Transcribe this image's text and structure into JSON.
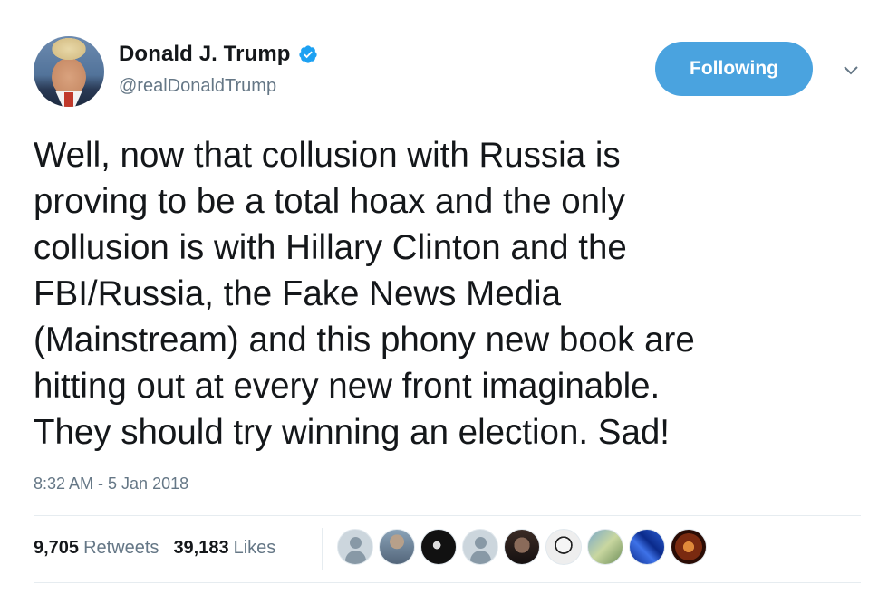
{
  "user": {
    "display_name": "Donald J. Trump",
    "handle": "@realDonaldTrump",
    "verified": true,
    "avatar_icon": "profile-photo"
  },
  "follow_button": {
    "label": "Following"
  },
  "menu_icon": "chevron-down-icon",
  "tweet": {
    "text": "Well, now that collusion with Russia is\nproving to be a total hoax and the only\ncollusion is with Hillary Clinton and the\nFBI/Russia, the Fake News Media\n(Mainstream) and this phony new book are\nhitting out at every new front imaginable.\nThey should try winning an election. Sad!",
    "timestamp": "8:32 AM - 5 Jan 2018"
  },
  "stats": {
    "retweets_count": "9,705",
    "retweets_label": "Retweets",
    "likes_count": "39,183",
    "likes_label": "Likes"
  },
  "likers": [
    "default-avatar",
    "avatar-2",
    "avatar-3",
    "default-avatar",
    "avatar-5",
    "avatar-6",
    "avatar-7",
    "avatar-8",
    "avatar-9",
    "avatar-10"
  ],
  "colors": {
    "accent": "#4aa3df",
    "text_primary": "#14171a",
    "text_secondary": "#657786",
    "verified_badge": "#1da1f2"
  }
}
